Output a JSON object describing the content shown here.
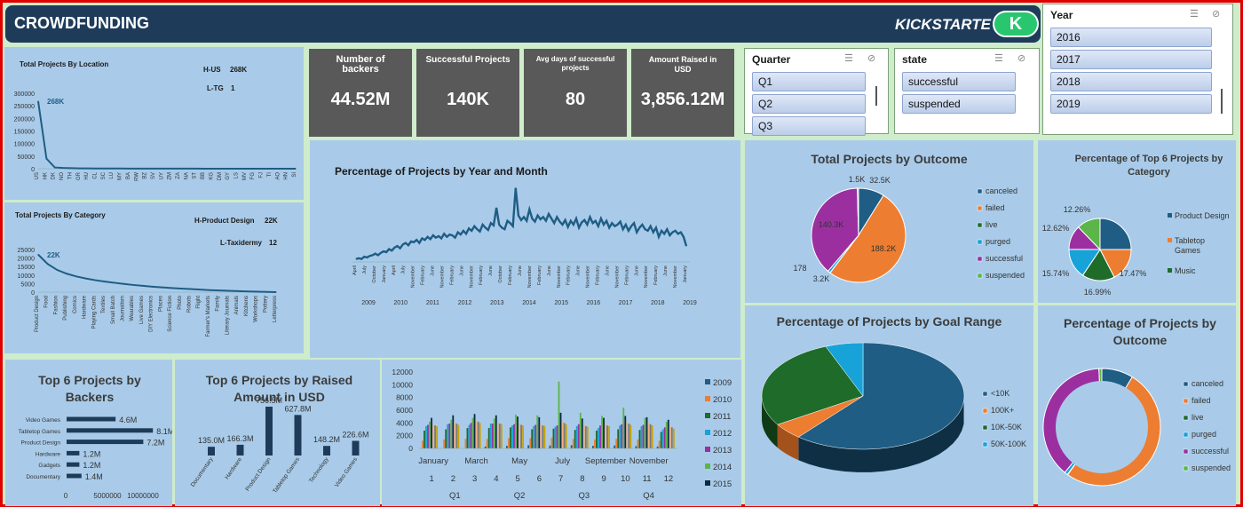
{
  "header": {
    "title": "CROWDFUNDING",
    "brand": "KICKSTARTE",
    "logo_letter": "K"
  },
  "slicers": {
    "year": {
      "title": "Year",
      "items": [
        "2016",
        "2017",
        "2018",
        "2019"
      ]
    },
    "quarter": {
      "title": "Quarter",
      "items": [
        "Q1",
        "Q2",
        "Q3"
      ]
    },
    "state": {
      "title": "state",
      "items": [
        "successful",
        "suspended"
      ]
    }
  },
  "kpis": [
    {
      "label": "Number of backers",
      "value": "44.52M"
    },
    {
      "label": "Successful Projects",
      "value": "140K"
    },
    {
      "label": "Avg days of successful projects",
      "value": "80"
    },
    {
      "label": "Amount Raised in USD",
      "value": "3,856.12M"
    }
  ],
  "location": {
    "title": "Total Projects By Location",
    "hi_label": "H-US",
    "hi_value": "268K",
    "lo_label": "L-TG",
    "lo_value": "1",
    "peak_label": "268K"
  },
  "category": {
    "title": "Total Projects By Category",
    "hi_label": "H-Product Design",
    "hi_value": "22K",
    "lo_label": "L-Taxidermy",
    "lo_value": "12",
    "peak_label": "22K"
  },
  "colors": {
    "navy": "#1e3c5a",
    "blue": "#1f5d84",
    "orange": "#ed7d31",
    "green": "#1e6b2a",
    "purple": "#9b2fa0",
    "cyan": "#17a2d8",
    "lime": "#5bb548",
    "panel": "#a9cbe9",
    "kpi": "#595959"
  },
  "chart_data": [
    {
      "type": "line",
      "title": "Total Projects By Location",
      "categories": [
        "US",
        "HK",
        "DK",
        "NO",
        "TH",
        "GR",
        "HU",
        "CL",
        "SC",
        "LU",
        "MY",
        "BA",
        "RW",
        "BZ",
        "SV",
        "UY",
        "ZM",
        "ZA",
        "NA",
        "ST",
        "BB",
        "KG",
        "DM",
        "GY",
        "LS",
        "MV",
        "FG",
        "FJ",
        "TI",
        "AO",
        "HN",
        "SI"
      ],
      "values": [
        268000,
        40000,
        5000,
        3000,
        2000,
        1500,
        1200,
        1000,
        900,
        800,
        700,
        600,
        500,
        450,
        400,
        350,
        300,
        280,
        260,
        240,
        220,
        200,
        180,
        160,
        140,
        120,
        100,
        80,
        60,
        40,
        20,
        1
      ],
      "yticks": [
        0,
        50000,
        100000,
        150000,
        200000,
        250000,
        300000
      ],
      "ylim": [
        0,
        300000
      ]
    },
    {
      "type": "line",
      "title": "Total Projects By Category",
      "categories": [
        "Product Design",
        "Food",
        "Fashion",
        "Publishing",
        "Comics",
        "Hardware",
        "Playing Cards",
        "Textiles",
        "Small Batch",
        "Journalism",
        "Wearables",
        "Live Games",
        "DIY Electronics",
        "Places",
        "Science Fiction",
        "Photo",
        "Robots",
        "Flight",
        "Farmer's Markets",
        "Family",
        "Literary Journals",
        "Animals",
        "Kitchens",
        "Workshops",
        "Pottery",
        "Letterpress"
      ],
      "values": [
        22000,
        16500,
        13000,
        10800,
        9200,
        8000,
        7000,
        6200,
        5500,
        4800,
        4200,
        3700,
        3200,
        2800,
        2400,
        2100,
        1800,
        1500,
        1200,
        1000,
        800,
        600,
        400,
        250,
        120,
        12
      ],
      "yticks": [
        0,
        5000,
        10000,
        15000,
        20000,
        25000
      ],
      "ylim": [
        0,
        25000
      ]
    },
    {
      "type": "line",
      "title": "Percentage of Projects by Year and Month",
      "years": [
        "2009",
        "2010",
        "2011",
        "2012",
        "2013",
        "2014",
        "2015",
        "2016",
        "2017",
        "2018",
        "2019"
      ],
      "month_labels": [
        "April",
        "July",
        "October",
        "January",
        "April",
        "July",
        "November",
        "February",
        "June",
        "November",
        "February",
        "June",
        "November",
        "February",
        "June",
        "October",
        "February",
        "June",
        "November",
        "February",
        "June",
        "November",
        "February",
        "June",
        "November",
        "February",
        "June",
        "November",
        "February",
        "June",
        "November",
        "February",
        "June",
        "November",
        "January"
      ],
      "values": [
        0.05,
        0.06,
        0.05,
        0.08,
        0.07,
        0.09,
        0.1,
        0.12,
        0.1,
        0.13,
        0.15,
        0.14,
        0.18,
        0.16,
        0.2,
        0.22,
        0.19,
        0.24,
        0.26,
        0.23,
        0.28,
        0.27,
        0.3,
        0.26,
        0.32,
        0.3,
        0.34,
        0.31,
        0.36,
        0.33,
        0.35,
        0.32,
        0.38,
        0.34,
        0.37,
        0.36,
        0.33,
        0.4,
        0.37,
        0.42,
        0.38,
        0.45,
        0.42,
        0.48,
        0.44,
        0.41,
        0.5,
        0.46,
        0.43,
        0.52,
        0.49,
        0.72,
        0.5,
        0.46,
        0.44,
        0.55,
        0.52,
        0.48,
        0.98,
        0.62,
        0.56,
        0.6,
        0.55,
        0.7,
        0.58,
        0.54,
        0.62,
        0.57,
        0.6,
        0.55,
        0.64,
        0.58,
        0.52,
        0.6,
        0.54,
        0.5,
        0.56,
        0.47,
        0.55,
        0.5,
        0.58,
        0.46,
        0.53,
        0.56,
        0.5,
        0.6,
        0.52,
        0.55,
        0.48,
        0.58,
        0.5,
        0.55,
        0.46,
        0.52,
        0.48,
        0.5,
        0.54,
        0.44,
        0.5,
        0.42,
        0.48,
        0.52,
        0.4,
        0.46,
        0.5,
        0.44,
        0.42,
        0.48,
        0.4,
        0.46,
        0.34,
        0.42,
        0.38,
        0.44,
        0.36,
        0.4,
        0.42,
        0.38,
        0.4,
        0.34,
        0.22
      ]
    },
    {
      "type": "pie",
      "title": "Total Projects by Outcome",
      "series": [
        {
          "name": "canceled",
          "value": 32.5,
          "label": "32.5K",
          "color": "#1f5d84"
        },
        {
          "name": "failed",
          "value": 188.2,
          "label": "188.2K",
          "color": "#ed7d31"
        },
        {
          "name": "live",
          "value": 0.178,
          "label": "178",
          "color": "#1e6b2a"
        },
        {
          "name": "purged",
          "value": 3.2,
          "label": "3.2K",
          "color": "#17a2d8"
        },
        {
          "name": "successful",
          "value": 140.3,
          "label": "140.3K",
          "color": "#9b2fa0"
        },
        {
          "name": "suspended",
          "value": 1.5,
          "label": "1.5K",
          "color": "#5bb548"
        }
      ]
    },
    {
      "type": "pie",
      "title": "Percentage of Top 6 Projects by Category",
      "series": [
        {
          "name": "Product Design",
          "value": 25.0,
          "label": "",
          "color": "#1f5d84"
        },
        {
          "name": "Tabletop Games",
          "value": 17.47,
          "label": "17.47%",
          "color": "#ed7d31"
        },
        {
          "name": "Music",
          "value": 16.99,
          "label": "16.99%",
          "color": "#1e6b2a"
        },
        {
          "name": "",
          "value": 15.74,
          "label": "15.74%",
          "color": "#17a2d8"
        },
        {
          "name": "",
          "value": 12.62,
          "label": "12.62%",
          "color": "#9b2fa0"
        },
        {
          "name": "",
          "value": 12.26,
          "label": "12.26%",
          "color": "#5bb548"
        }
      ]
    },
    {
      "type": "pie",
      "title": "Percentage of Projects by Goal Range",
      "series": [
        {
          "name": "<10K",
          "value": 61,
          "color": "#1f5d84"
        },
        {
          "name": "100K+",
          "value": 5,
          "color": "#ed7d31"
        },
        {
          "name": "10K-50K",
          "value": 28,
          "color": "#1e6b2a"
        },
        {
          "name": "50K-100K",
          "value": 6,
          "color": "#17a2d8"
        }
      ]
    },
    {
      "type": "pie",
      "title": "Percentage of Projects by Outcome",
      "donut": true,
      "series": [
        {
          "name": "canceled",
          "value": 8.7,
          "color": "#1f5d84"
        },
        {
          "name": "failed",
          "value": 51.2,
          "color": "#ed7d31"
        },
        {
          "name": "live",
          "value": 0.1,
          "color": "#1e6b2a"
        },
        {
          "name": "purged",
          "value": 0.9,
          "color": "#17a2d8"
        },
        {
          "name": "successful",
          "value": 38.3,
          "color": "#9b2fa0"
        },
        {
          "name": "suspended",
          "value": 0.8,
          "color": "#5bb548"
        }
      ]
    },
    {
      "type": "bar",
      "orientation": "horizontal",
      "title": "Top 6 Projects by Backers",
      "categories": [
        "Video Games",
        "Tabletop Games",
        "Product Design",
        "Hardware",
        "Gadgets",
        "Documentary"
      ],
      "values": [
        4600000,
        8100000,
        7200000,
        1200000,
        1200000,
        1400000
      ],
      "labels": [
        "4.6M",
        "8.1M",
        "7.2M",
        "1.2M",
        "1.2M",
        "1.4M"
      ],
      "xticks": [
        "0",
        "5000000",
        "10000000"
      ],
      "xlim": [
        0,
        10000000
      ]
    },
    {
      "type": "bar",
      "title": "Top 6  Projects by Raised Amount in USD",
      "categories": [
        "Documentary",
        "Hardware",
        "Product Design",
        "Tabletop Games",
        "Technology",
        "Video Games"
      ],
      "values": [
        135.0,
        166.3,
        756.5,
        627.8,
        148.2,
        226.6
      ],
      "labels": [
        "135.0M",
        "166.3M",
        "756.5M",
        "627.8M",
        "148.2M",
        "226.6M"
      ]
    },
    {
      "type": "bar",
      "title": "",
      "categories": [
        "1",
        "2",
        "3",
        "4",
        "5",
        "6",
        "7",
        "8",
        "9",
        "10",
        "11",
        "12"
      ],
      "month_names": [
        "January",
        "March",
        "May",
        "July",
        "September",
        "November"
      ],
      "quarters": [
        "Q1",
        "Q2",
        "Q3",
        "Q4"
      ],
      "yticks": [
        0,
        2000,
        4000,
        6000,
        8000,
        10000,
        12000
      ],
      "ylim": [
        0,
        12000
      ],
      "series": [
        {
          "name": "2009",
          "color": "#1f5d84",
          "values": [
            0,
            0,
            0,
            300,
            400,
            500,
            450,
            500,
            400,
            450,
            350,
            300
          ]
        },
        {
          "name": "2010",
          "color": "#ed7d31",
          "values": [
            1200,
            1400,
            1500,
            1500,
            1600,
            1600,
            1700,
            1500,
            1400,
            1500,
            1400,
            1200
          ]
        },
        {
          "name": "2011",
          "color": "#1e6b2a",
          "values": [
            2800,
            3000,
            3200,
            3200,
            3300,
            3000,
            3100,
            2900,
            2800,
            3000,
            2900,
            2600
          ]
        },
        {
          "name": "2012",
          "color": "#17a2d8",
          "values": [
            3500,
            3800,
            3700,
            3900,
            3600,
            3500,
            3400,
            3500,
            3200,
            3600,
            3500,
            3000
          ]
        },
        {
          "name": "2013",
          "color": "#9b2fa0",
          "values": [
            3700,
            3900,
            4000,
            3900,
            3800,
            3700,
            3600,
            3800,
            3600,
            3800,
            3700,
            3300
          ]
        },
        {
          "name": "2014",
          "color": "#5bb548",
          "values": [
            4200,
            4500,
            4800,
            4700,
            5300,
            5200,
            10500,
            5600,
            5100,
            6400,
            4800,
            4200
          ]
        },
        {
          "name": "2015",
          "color": "#0d2a40",
          "values": [
            4800,
            5200,
            5400,
            5200,
            5000,
            4900,
            5600,
            4700,
            4800,
            5100,
            4900,
            4500
          ]
        },
        {
          "name": "2016",
          "color": "#f2b082",
          "values": [
            3800,
            4100,
            4300,
            4000,
            3900,
            3800,
            4200,
            3700,
            3800,
            4200,
            4000,
            3500
          ]
        },
        {
          "name": "2017",
          "color": "#7a7a7a",
          "values": [
            3600,
            3900,
            4200,
            3900,
            3700,
            3600,
            4000,
            3500,
            3600,
            3900,
            3800,
            3300
          ]
        },
        {
          "name": "2018",
          "color": "#c9a300",
          "values": [
            3500,
            3700,
            4000,
            3800,
            3600,
            3500,
            3800,
            3400,
            3500,
            3700,
            3600,
            3100
          ]
        }
      ],
      "legend": [
        "2009",
        "2010",
        "2011",
        "2012",
        "2013",
        "2014",
        "2015"
      ]
    }
  ]
}
